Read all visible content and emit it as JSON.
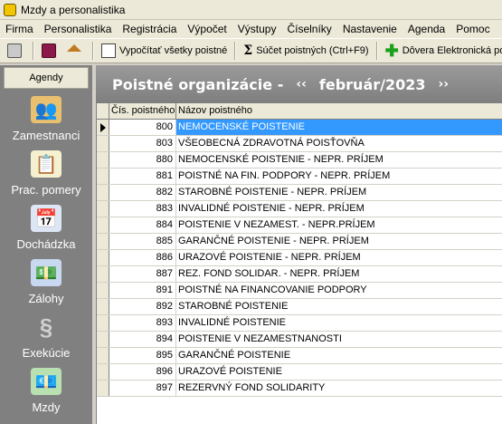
{
  "window": {
    "title": "Mzdy a personalistika"
  },
  "menu": [
    "Firma",
    "Personalistika",
    "Registrácia",
    "Výpočet",
    "Výstupy",
    "Číselníky",
    "Nastavenie",
    "Agenda",
    "Pomoc"
  ],
  "toolbar": {
    "calc_all_label": "Vypočítať všetky poistné",
    "sum_label": "Súčet poistných (Ctrl+F9)",
    "trust_label": "Dôvera Elektronická pob"
  },
  "sidebar": {
    "header": "Agendy",
    "items": [
      {
        "label": "Zamestnanci",
        "icon": "people-icon"
      },
      {
        "label": "Prac. pomery",
        "icon": "contract-icon"
      },
      {
        "label": "Dochádzka",
        "icon": "calendar-clock-icon"
      },
      {
        "label": "Zálohy",
        "icon": "money-hand-icon"
      },
      {
        "label": "Exekúcie",
        "icon": "paragraph-icon"
      },
      {
        "label": "Mzdy",
        "icon": "money-icon"
      }
    ]
  },
  "main": {
    "title": "Poistné organizácie -",
    "prev": "‹‹",
    "period": "február/2023",
    "next": "››"
  },
  "grid": {
    "columns": [
      "Čís. poistného",
      "Názov poistného"
    ],
    "rows": [
      [
        "800",
        "NEMOCENSKÉ POISTENIE"
      ],
      [
        "803",
        "VŠEOBECNÁ ZDRAVOTNÁ POISŤOVŇA"
      ],
      [
        "880",
        "NEMOCENSKÉ POISTENIE - NEPR. PRÍJEM"
      ],
      [
        "881",
        "POISTNÉ NA FIN. PODPORY - NEPR. PRÍJEM"
      ],
      [
        "882",
        "STAROBNÉ POISTENIE - NEPR. PRÍJEM"
      ],
      [
        "883",
        "INVALIDNÉ POISTENIE - NEPR. PRÍJEM"
      ],
      [
        "884",
        "POISTENIE V NEZAMEST. - NEPR.PRÍJEM"
      ],
      [
        "885",
        "GARANČNÉ POISTENIE - NEPR. PRÍJEM"
      ],
      [
        "886",
        "URAZOVÉ POISTENIE - NEPR. PRÍJEM"
      ],
      [
        "887",
        "REZ. FOND SOLIDAR. - NEPR. PRÍJEM"
      ],
      [
        "891",
        "POISTNÉ NA FINANCOVANIE PODPORY"
      ],
      [
        "892",
        "STAROBNÉ POISTENIE"
      ],
      [
        "893",
        "INVALIDNÉ POISTENIE"
      ],
      [
        "894",
        "POISTENIE V NEZAMESTNANOSTI"
      ],
      [
        "895",
        "GARANČNÉ POISTENIE"
      ],
      [
        "896",
        "URAZOVÉ POISTENIE"
      ],
      [
        "897",
        "REZERVNÝ FOND SOLIDARITY"
      ]
    ],
    "selected_row": 0,
    "colors": {
      "selection": "#3399ff"
    }
  }
}
